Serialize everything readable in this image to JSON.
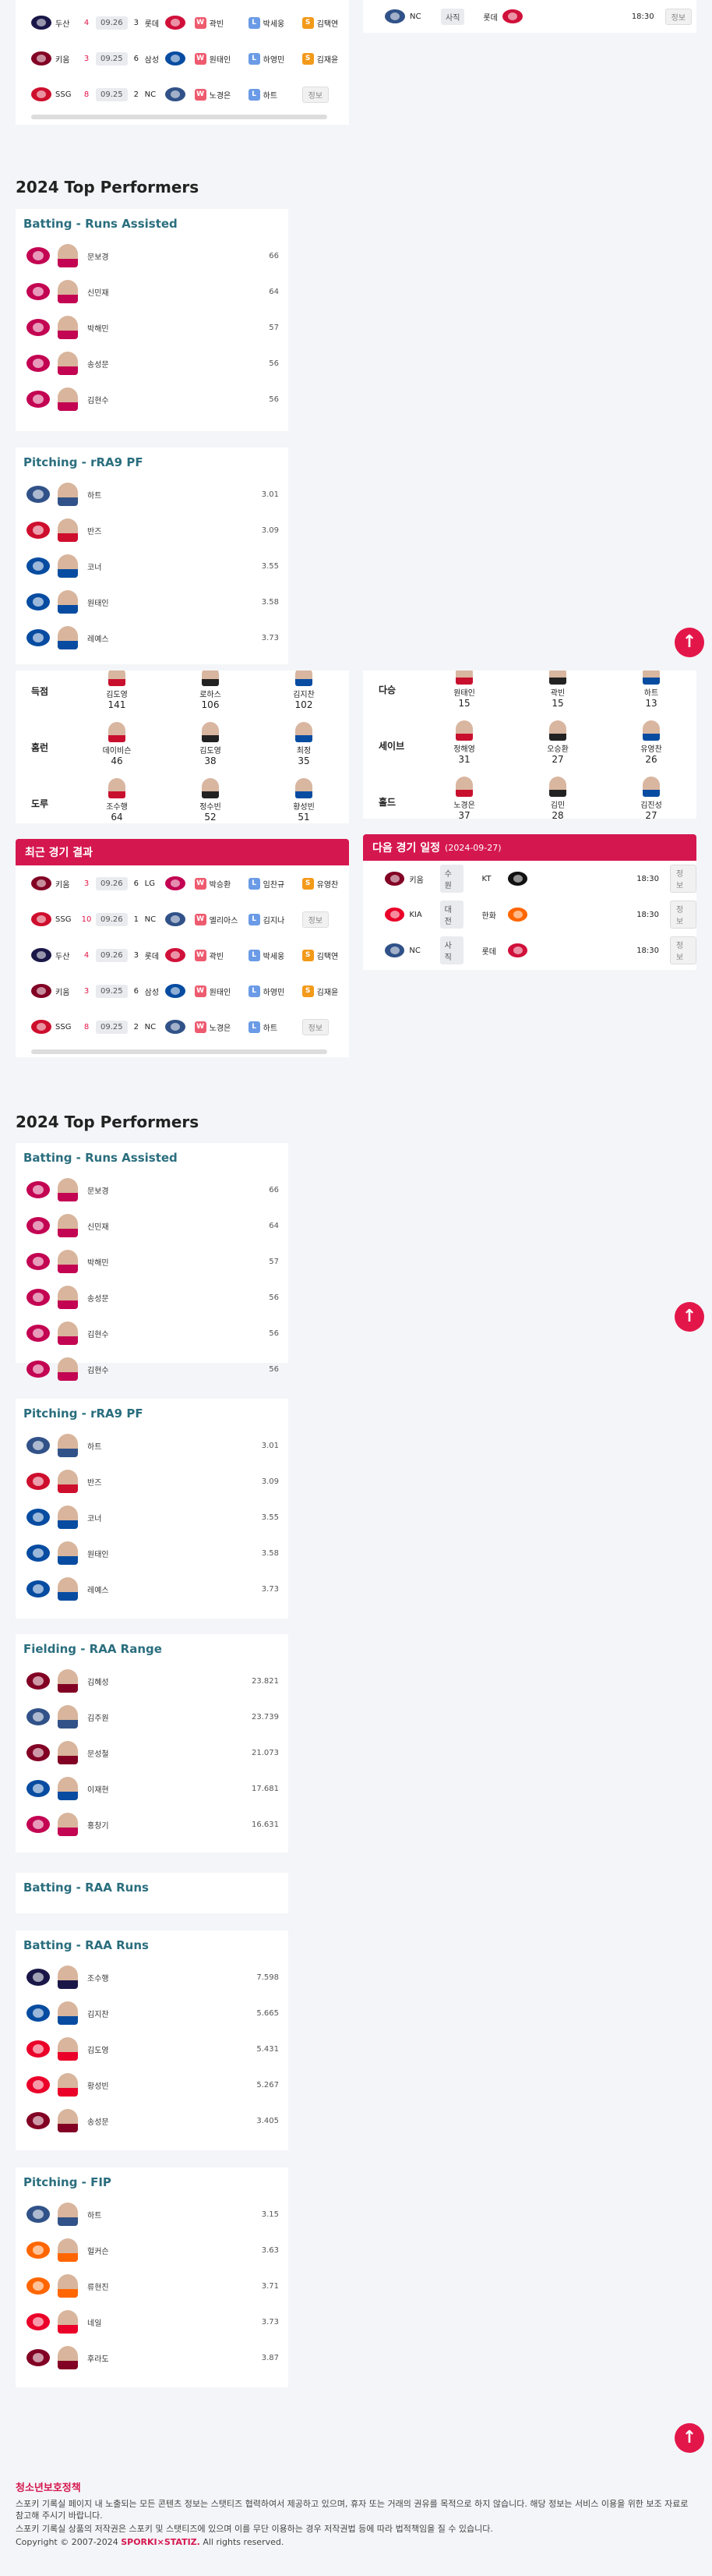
{
  "colors": {
    "accent": "#d5174f",
    "teal": "#2a6e7e",
    "up": "#e3164a"
  },
  "top_games": [
    {
      "home": "두산",
      "hscore": "4",
      "date": "09.26",
      "ascore": "3",
      "away": "롯데",
      "w": "W",
      "w_name": "곽빈",
      "l": "L",
      "l_name": "박세웅",
      "s": "S",
      "s_name": "김택연"
    },
    {
      "home": "키움",
      "hscore": "3",
      "date": "09.25",
      "ascore": "6",
      "away": "삼성",
      "w": "W",
      "w_name": "원태인",
      "l": "L",
      "l_name": "하영민",
      "s": "S",
      "s_name": "김재윤"
    },
    {
      "home": "SSG",
      "hscore": "8",
      "date": "09.25",
      "ascore": "2",
      "away": "NC",
      "w": "W",
      "w_name": "노경은",
      "l": "L",
      "l_name": "하트",
      "info": "정보"
    }
  ],
  "top_next": {
    "home": "NC",
    "stadium": "사직",
    "away": "롯데",
    "time": "18:30",
    "info": "정보"
  },
  "section_title": "2024 Top Performers",
  "ra_card": {
    "title": "Batting - Runs Assisted",
    "rows": [
      {
        "name": "문보경",
        "val": "66"
      },
      {
        "name": "신민재",
        "val": "64"
      },
      {
        "name": "박해민",
        "val": "57"
      },
      {
        "name": "송성문",
        "val": "56"
      },
      {
        "name": "김현수",
        "val": "56"
      }
    ]
  },
  "pf_card": {
    "title": "Pitching - rRA9 PF",
    "rows": [
      {
        "name": "하트",
        "val": "3.01"
      },
      {
        "name": "반즈",
        "val": "3.09"
      },
      {
        "name": "코너",
        "val": "3.55"
      },
      {
        "name": "원태인",
        "val": "3.58"
      },
      {
        "name": "레예스",
        "val": "3.73"
      }
    ]
  },
  "records_left": [
    {
      "label": "득점",
      "p": [
        {
          "name": "김도영",
          "n": "141"
        },
        {
          "name": "로하스",
          "n": "106"
        },
        {
          "name": "김지찬",
          "n": "102"
        }
      ]
    },
    {
      "label": "홈런",
      "p": [
        {
          "name": "데이비슨",
          "n": "46"
        },
        {
          "name": "김도영",
          "n": "38"
        },
        {
          "name": "최정",
          "n": "35"
        }
      ]
    },
    {
      "label": "도루",
      "p": [
        {
          "name": "조수행",
          "n": "64"
        },
        {
          "name": "정수빈",
          "n": "52"
        },
        {
          "name": "황성빈",
          "n": "51"
        }
      ]
    }
  ],
  "records_right": [
    {
      "label": "다승",
      "p": [
        {
          "name": "원태인",
          "n": "15"
        },
        {
          "name": "곽빈",
          "n": "15"
        },
        {
          "name": "하트",
          "n": "13"
        }
      ]
    },
    {
      "label": "세이브",
      "p": [
        {
          "name": "정해영",
          "n": "31"
        },
        {
          "name": "오승환",
          "n": "27"
        },
        {
          "name": "유영찬",
          "n": "26"
        }
      ]
    },
    {
      "label": "홀드",
      "p": [
        {
          "name": "노경은",
          "n": "37"
        },
        {
          "name": "김민",
          "n": "28"
        },
        {
          "name": "김진성",
          "n": "27"
        }
      ]
    }
  ],
  "recent_title": "최근 경기 결과",
  "recent_games": [
    {
      "home": "키움",
      "hscore": "3",
      "date": "09.26",
      "ascore": "6",
      "away": "LG",
      "w": "W",
      "w_name": "박승환",
      "l": "L",
      "l_name": "임찬규",
      "s": "S",
      "s_name": "유영찬"
    },
    {
      "home": "SSG",
      "hscore": "10",
      "date": "09.26",
      "ascore": "1",
      "away": "NC",
      "w": "W",
      "w_name": "엘리아스",
      "l": "L",
      "l_name": "김지나",
      "info": "정보"
    },
    {
      "home": "두산",
      "hscore": "4",
      "date": "09.26",
      "ascore": "3",
      "away": "롯데",
      "w": "W",
      "w_name": "곽빈",
      "l": "L",
      "l_name": "박세웅",
      "s": "S",
      "s_name": "김택연"
    },
    {
      "home": "키움",
      "hscore": "3",
      "date": "09.25",
      "ascore": "6",
      "away": "삼성",
      "w": "W",
      "w_name": "원태인",
      "l": "L",
      "l_name": "하영민",
      "s": "S",
      "s_name": "김재윤"
    },
    {
      "home": "SSG",
      "hscore": "8",
      "date": "09.25",
      "ascore": "2",
      "away": "NC",
      "w": "W",
      "w_name": "노경은",
      "l": "L",
      "l_name": "하트",
      "info": "정보"
    }
  ],
  "next_title": "다음 경기 일정",
  "next_date": "(2024-09-27)",
  "next_games": [
    {
      "home": "키움",
      "stadium": "수원",
      "away": "KT",
      "time": "18:30",
      "info": "정보"
    },
    {
      "home": "KIA",
      "stadium": "대전",
      "away": "한화",
      "time": "18:30",
      "info": "정보"
    },
    {
      "home": "NC",
      "stadium": "사직",
      "away": "롯데",
      "time": "18:30",
      "info": "정보"
    }
  ],
  "bottom_cards": [
    {
      "title": "Batting - Runs Assisted",
      "rows": [
        {
          "name": "문보경",
          "val": "66"
        },
        {
          "name": "신민재",
          "val": "64"
        },
        {
          "name": "박해민",
          "val": "57"
        },
        {
          "name": "송성문",
          "val": "56"
        },
        {
          "name": "김현수",
          "val": "56"
        },
        {
          "name": "김현수",
          "val": "56"
        }
      ]
    },
    {
      "title": "Pitching - rRA9 PF",
      "rows": [
        {
          "name": "하트",
          "val": "3.01"
        },
        {
          "name": "반즈",
          "val": "3.09"
        },
        {
          "name": "코너",
          "val": "3.55"
        },
        {
          "name": "원태인",
          "val": "3.58"
        },
        {
          "name": "레예스",
          "val": "3.73"
        }
      ]
    },
    {
      "title": "Fielding - RAA Range",
      "rows": [
        {
          "name": "김혜성",
          "val": "23.821"
        },
        {
          "name": "김주원",
          "val": "23.739"
        },
        {
          "name": "문성철",
          "val": "21.073"
        },
        {
          "name": "이재현",
          "val": "17.681"
        },
        {
          "name": "홍창기",
          "val": "16.631"
        }
      ]
    },
    {
      "title": "Batting - RAA Runs",
      "rows": []
    },
    {
      "title": "Batting - RAA Runs",
      "rows": [
        {
          "name": "조수행",
          "val": "7.598"
        },
        {
          "name": "김지찬",
          "val": "5.665"
        },
        {
          "name": "김도영",
          "val": "5.431"
        },
        {
          "name": "황성빈",
          "val": "5.267"
        },
        {
          "name": "송성문",
          "val": "3.405"
        }
      ]
    },
    {
      "title": "Pitching - FIP",
      "rows": [
        {
          "name": "하트",
          "val": "3.15"
        },
        {
          "name": "헐커슨",
          "val": "3.63"
        },
        {
          "name": "류현진",
          "val": "3.71"
        },
        {
          "name": "네일",
          "val": "3.73"
        },
        {
          "name": "후라도",
          "val": "3.87"
        }
      ]
    }
  ],
  "footer": {
    "title": "청소년보호정책",
    "line1": "스포키 기록실 페이지 내 노출되는 모든 콘텐츠 정보는 스탯티즈 협력하여서 제공하고 있으며, 휴자 또는 거래의 권유를 목적으로 하지 않습니다. 해당 정보는 서비스 이용을 위한 보조 자료로 참고해 주시기 바랍니다.",
    "line2": "스포키 기록실 상품의 저작권은 스포키 및 스탯티즈에 있으며 이를 무단 이용하는 경우 저작권법 등에 따라 법적책임을 질 수 있습니다.",
    "copyright_pre": "Copyright © 2007-2024 ",
    "brand": "SPORKI×STATIZ.",
    "copyright_post": " All rights reserved."
  },
  "up_icon": "arrow-up-icon"
}
